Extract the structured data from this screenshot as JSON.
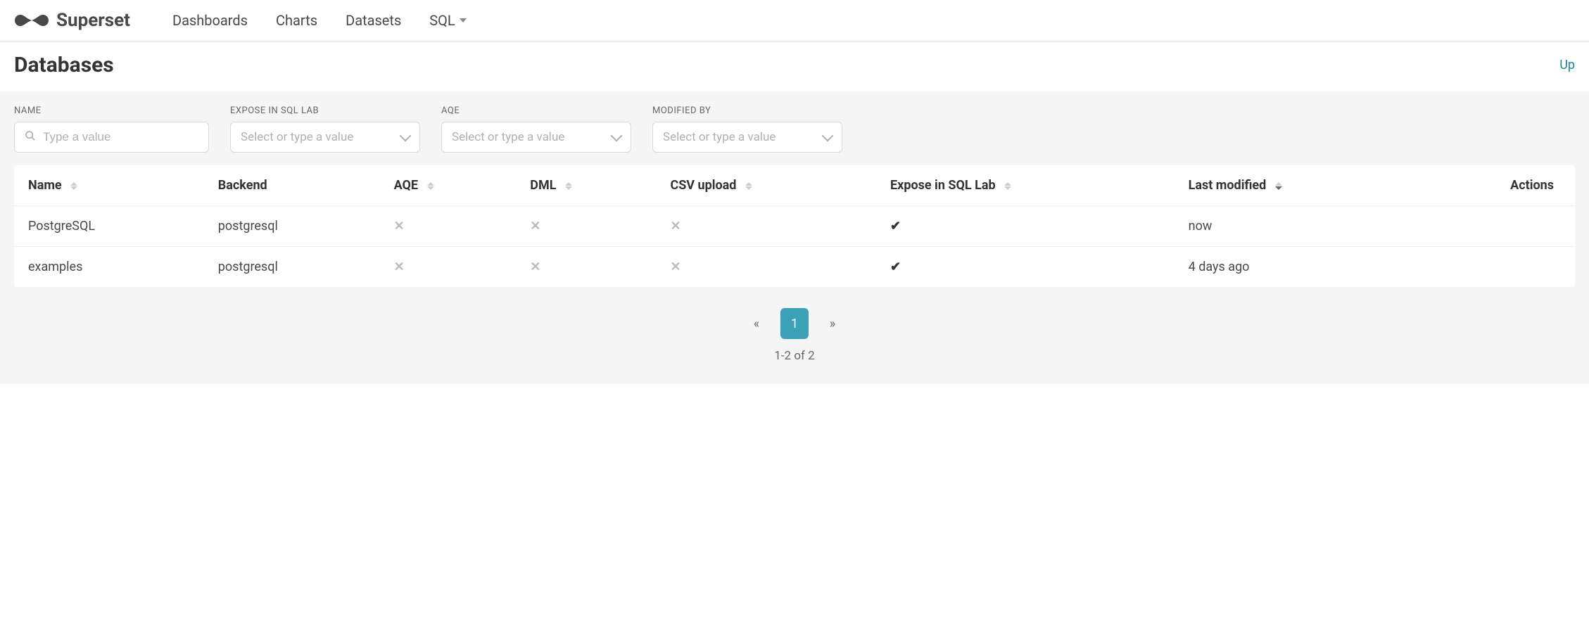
{
  "brand": {
    "name": "Superset"
  },
  "nav": {
    "items": [
      "Dashboards",
      "Charts",
      "Datasets",
      "SQL"
    ]
  },
  "page": {
    "title": "Databases",
    "right_link": "Up"
  },
  "filters": {
    "name": {
      "label": "NAME",
      "placeholder": "Type a value"
    },
    "expose": {
      "label": "EXPOSE IN SQL LAB",
      "placeholder": "Select or type a value"
    },
    "aqe": {
      "label": "AQE",
      "placeholder": "Select or type a value"
    },
    "modified_by": {
      "label": "MODIFIED BY",
      "placeholder": "Select or type a value"
    }
  },
  "table": {
    "columns": {
      "name": "Name",
      "backend": "Backend",
      "aqe": "AQE",
      "dml": "DML",
      "csv_upload": "CSV upload",
      "expose": "Expose in SQL Lab",
      "last_modified": "Last modified",
      "actions": "Actions"
    },
    "rows": [
      {
        "name": "PostgreSQL",
        "backend": "postgresql",
        "aqe": "✕",
        "dml": "✕",
        "csv_upload": "✕",
        "expose": "✔",
        "last_modified": "now"
      },
      {
        "name": "examples",
        "backend": "postgresql",
        "aqe": "✕",
        "dml": "✕",
        "csv_upload": "✕",
        "expose": "✔",
        "last_modified": "4 days ago"
      }
    ]
  },
  "pagination": {
    "prev": "«",
    "current": "1",
    "next": "»",
    "summary": "1-2 of 2"
  }
}
